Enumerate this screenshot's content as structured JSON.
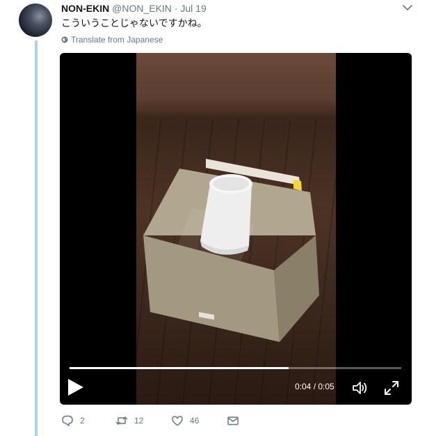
{
  "tweet": {
    "display_name": "NON-EKIN",
    "handle": "@NON_EKIN",
    "separator": "·",
    "time": "Jul 19",
    "text": "こういうことじゃないですかね。",
    "translate_label": "Translate from Japanese"
  },
  "video": {
    "current_time": "0:04",
    "duration": "0:05",
    "time_separator": " / ",
    "progress_fraction": 0.66
  },
  "actions": {
    "reply_count": "2",
    "retweet_count": "12",
    "like_count": "46"
  },
  "colors": {
    "thread_line": "#a9d4ee",
    "secondary_text": "#657786",
    "primary_text": "#14171a"
  },
  "icons": [
    "chevron-down-icon",
    "globe-icon",
    "play-icon",
    "volume-icon",
    "fullscreen-icon",
    "reply-icon",
    "retweet-icon",
    "like-icon",
    "dm-icon"
  ]
}
